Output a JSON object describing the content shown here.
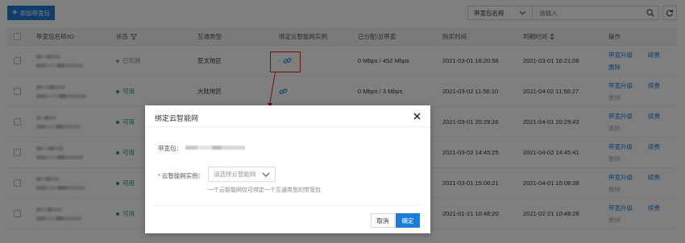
{
  "toolbar": {
    "add_label": "添加带宽包",
    "search_field": "带宽包名称",
    "search_placeholder": "请输入"
  },
  "table": {
    "headers": [
      "带宽包名称/ID",
      "状态",
      "互通类型",
      "绑定云智能网实例",
      "已分配/总带宽",
      "购买时间",
      "到期时间",
      "操作"
    ],
    "rows": [
      {
        "status": "已到期",
        "status_color": "gray",
        "type": "亚太地区",
        "bw": "0 Mbps / 452 Mbps",
        "buy": "2021-03-01 16:20:58",
        "exp": "2021-03-01 16:21:08",
        "op1": "带宽升级",
        "op2": "续费",
        "op3": "删除",
        "op3_disabled": false
      },
      {
        "status": "可用",
        "status_color": "green",
        "type": "大陆地区",
        "bw": "0 Mbps / 3 Mbps",
        "buy": "2021-03-02 11:56:10",
        "exp": "2021-04-02 11:56:27",
        "op1": "带宽升级",
        "op2": "续费",
        "op3": "删除",
        "op3_disabled": true
      },
      {
        "status": "可用",
        "status_color": "green",
        "type": "",
        "bw": "",
        "buy": "2021-03-01 20:29:26",
        "exp": "2021-04-01 20:29:43",
        "op1": "带宽升级",
        "op2": "续费",
        "op3": "删除",
        "op3_disabled": true
      },
      {
        "status": "可用",
        "status_color": "green",
        "type": "",
        "bw": "",
        "buy": "2021-03-02 14:45:25",
        "exp": "2021-04-02 14:45:41",
        "op1": "带宽升级",
        "op2": "续费",
        "op3": "删除",
        "op3_disabled": true
      },
      {
        "status": "可用",
        "status_color": "green",
        "type": "",
        "bw": "",
        "buy": "2021-03-01 15:08:21",
        "exp": "2021-04-01 15:08:38",
        "op1": "带宽升级",
        "op2": "续费",
        "op3": "删除",
        "op3_disabled": true
      },
      {
        "status": "可用",
        "status_color": "green",
        "type": "",
        "bw": "",
        "buy": "2021-01-21 10:48:20",
        "exp": "2021-02-21 10:48:28",
        "op1": "带宽升级",
        "op2": "续费",
        "op3": "删除",
        "op3_disabled": true
      }
    ]
  },
  "modal": {
    "title": "绑定云智能网",
    "label_package": "带宽包：",
    "label_ccn": "云智能网实例：",
    "required_mark": "*",
    "select_placeholder": "请选择云智能网",
    "hint": "一个云智能网仅可绑定一个互通类型的带宽包",
    "cancel": "取消",
    "ok": "确定"
  },
  "colors": {
    "primary": "#1f7bd8",
    "green": "#19a55a",
    "highlight": "#e02020"
  }
}
